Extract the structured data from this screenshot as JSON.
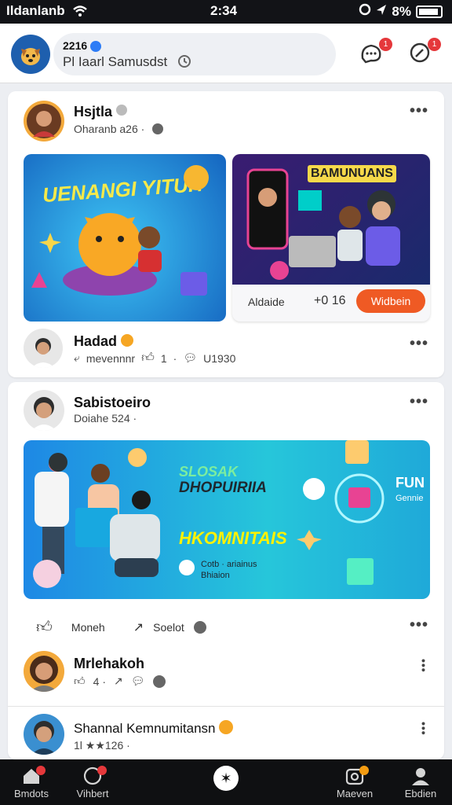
{
  "status": {
    "carrier": "Ildanlanb",
    "time": "2:34",
    "battery": "8%"
  },
  "header": {
    "line1": "2216",
    "line2": "Pl Iaarl Samusdst"
  },
  "post1": {
    "name": "Hsjtla",
    "meta": "Oharanb a26 ·",
    "left_image_title": "UENANGI YITUH",
    "right_image_title": "BAMUNUANS",
    "right_caption": "Aldaide",
    "right_count": "+0 16",
    "cta": "Widbein",
    "commenter": "Hadad",
    "comment_meta": "mevennnr",
    "like_count": "1",
    "comment_count": "U1930"
  },
  "post2": {
    "name": "Sabistoeiro",
    "meta": "Doiahe 524 ·",
    "banner_line1": "SLOSAK",
    "banner_line2": "DHOPUIRIIA",
    "banner_line3": "HKOMNITAIS",
    "banner_side": "FUN",
    "banner_side_sub": "Gennie",
    "banner_caption1": "Cotb · ariainus",
    "banner_caption2": "Bhiaion",
    "action1": "Moneh",
    "action2": "Soelot"
  },
  "post3": {
    "name": "Mrlehakoh",
    "meta": "4 ·"
  },
  "post4": {
    "name": "Shannal Kemnumitansn",
    "meta": "1l ★★126 ·"
  },
  "tabs": [
    {
      "label": "Bmdots"
    },
    {
      "label": "Vihbert"
    },
    {
      "label": "Maeven"
    },
    {
      "label": "Ebdien"
    }
  ],
  "colors": {
    "cta": "#ef5a24",
    "verified": "#2d7cf6",
    "badge": "#e5383b",
    "banner": "#1fa9d9"
  }
}
